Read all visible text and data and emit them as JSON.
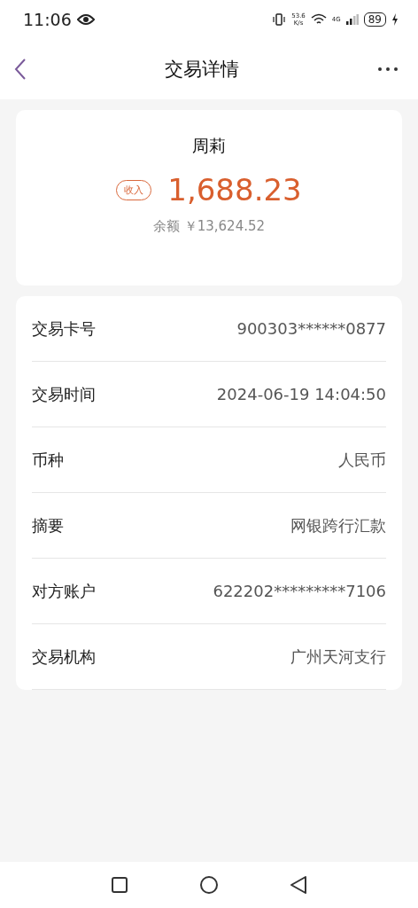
{
  "status_bar": {
    "time": "11:06",
    "speed_value": "53.6",
    "speed_unit": "K/s",
    "network": "4G",
    "battery": "89"
  },
  "header": {
    "title": "交易详情"
  },
  "summary": {
    "name": "周莉",
    "tag": "收入",
    "amount": "1,688.23",
    "balance_label": "余额",
    "balance": "￥13,624.52"
  },
  "details": [
    {
      "label": "交易卡号",
      "value": "900303******0877"
    },
    {
      "label": "交易时间",
      "value": "2024-06-19 14:04:50"
    },
    {
      "label": "币种",
      "value": "人民币"
    },
    {
      "label": "摘要",
      "value": "网银跨行汇款"
    },
    {
      "label": "对方账户",
      "value": "622202*********7106"
    },
    {
      "label": "交易机构",
      "value": "广州天河支行"
    }
  ]
}
